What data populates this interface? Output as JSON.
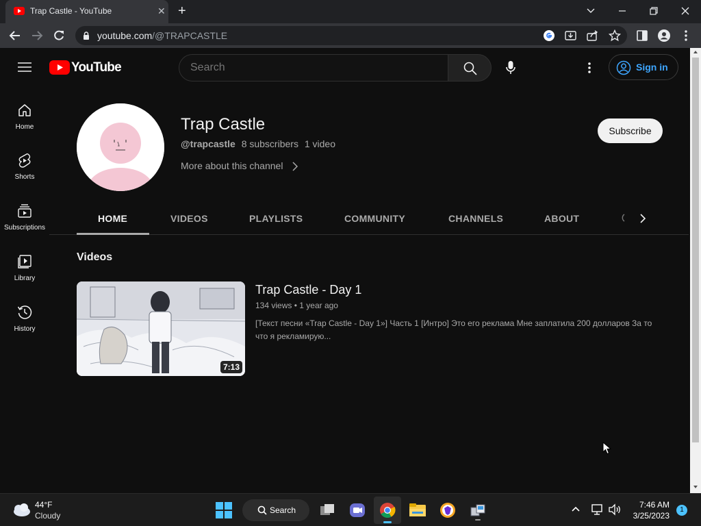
{
  "browser": {
    "tab_title": "Trap Castle - YouTube",
    "url_host": "youtube.com",
    "url_path": "/@TRAPCASTLE"
  },
  "masthead": {
    "logo_text": "YouTube",
    "search_placeholder": "Search",
    "signin_label": "Sign in"
  },
  "guide": {
    "items": [
      {
        "label": "Home",
        "icon": "home-icon"
      },
      {
        "label": "Shorts",
        "icon": "shorts-icon"
      },
      {
        "label": "Subscriptions",
        "icon": "subscriptions-icon"
      },
      {
        "label": "Library",
        "icon": "library-icon"
      },
      {
        "label": "History",
        "icon": "history-icon"
      }
    ]
  },
  "channel": {
    "name": "Trap Castle",
    "handle": "@trapcastle",
    "subscribers": "8 subscribers",
    "videos_count": "1 video",
    "more_about": "More about this channel",
    "subscribe_label": "Subscribe"
  },
  "tabs": [
    "HOME",
    "VIDEOS",
    "PLAYLISTS",
    "COMMUNITY",
    "CHANNELS",
    "ABOUT"
  ],
  "active_tab": "HOME",
  "section": {
    "heading": "Videos",
    "video": {
      "title": "Trap Castle - Day 1",
      "views": "134 views",
      "age": "1 year ago",
      "duration": "7:13",
      "description": "[Текст песни «Trap Castle - Day 1»] Часть 1 [Интро] Это его реклама Мне заплатила 200 долларов За то что я рекламирую..."
    }
  },
  "taskbar": {
    "weather_temp": "44°F",
    "weather_desc": "Cloudy",
    "search_label": "Search",
    "time": "7:46 AM",
    "date": "3/25/2023",
    "notification_count": "1"
  },
  "colors": {
    "youtube_red": "#ff0000",
    "link_blue": "#3ea6ff",
    "page_bg": "#0f0f0f"
  }
}
